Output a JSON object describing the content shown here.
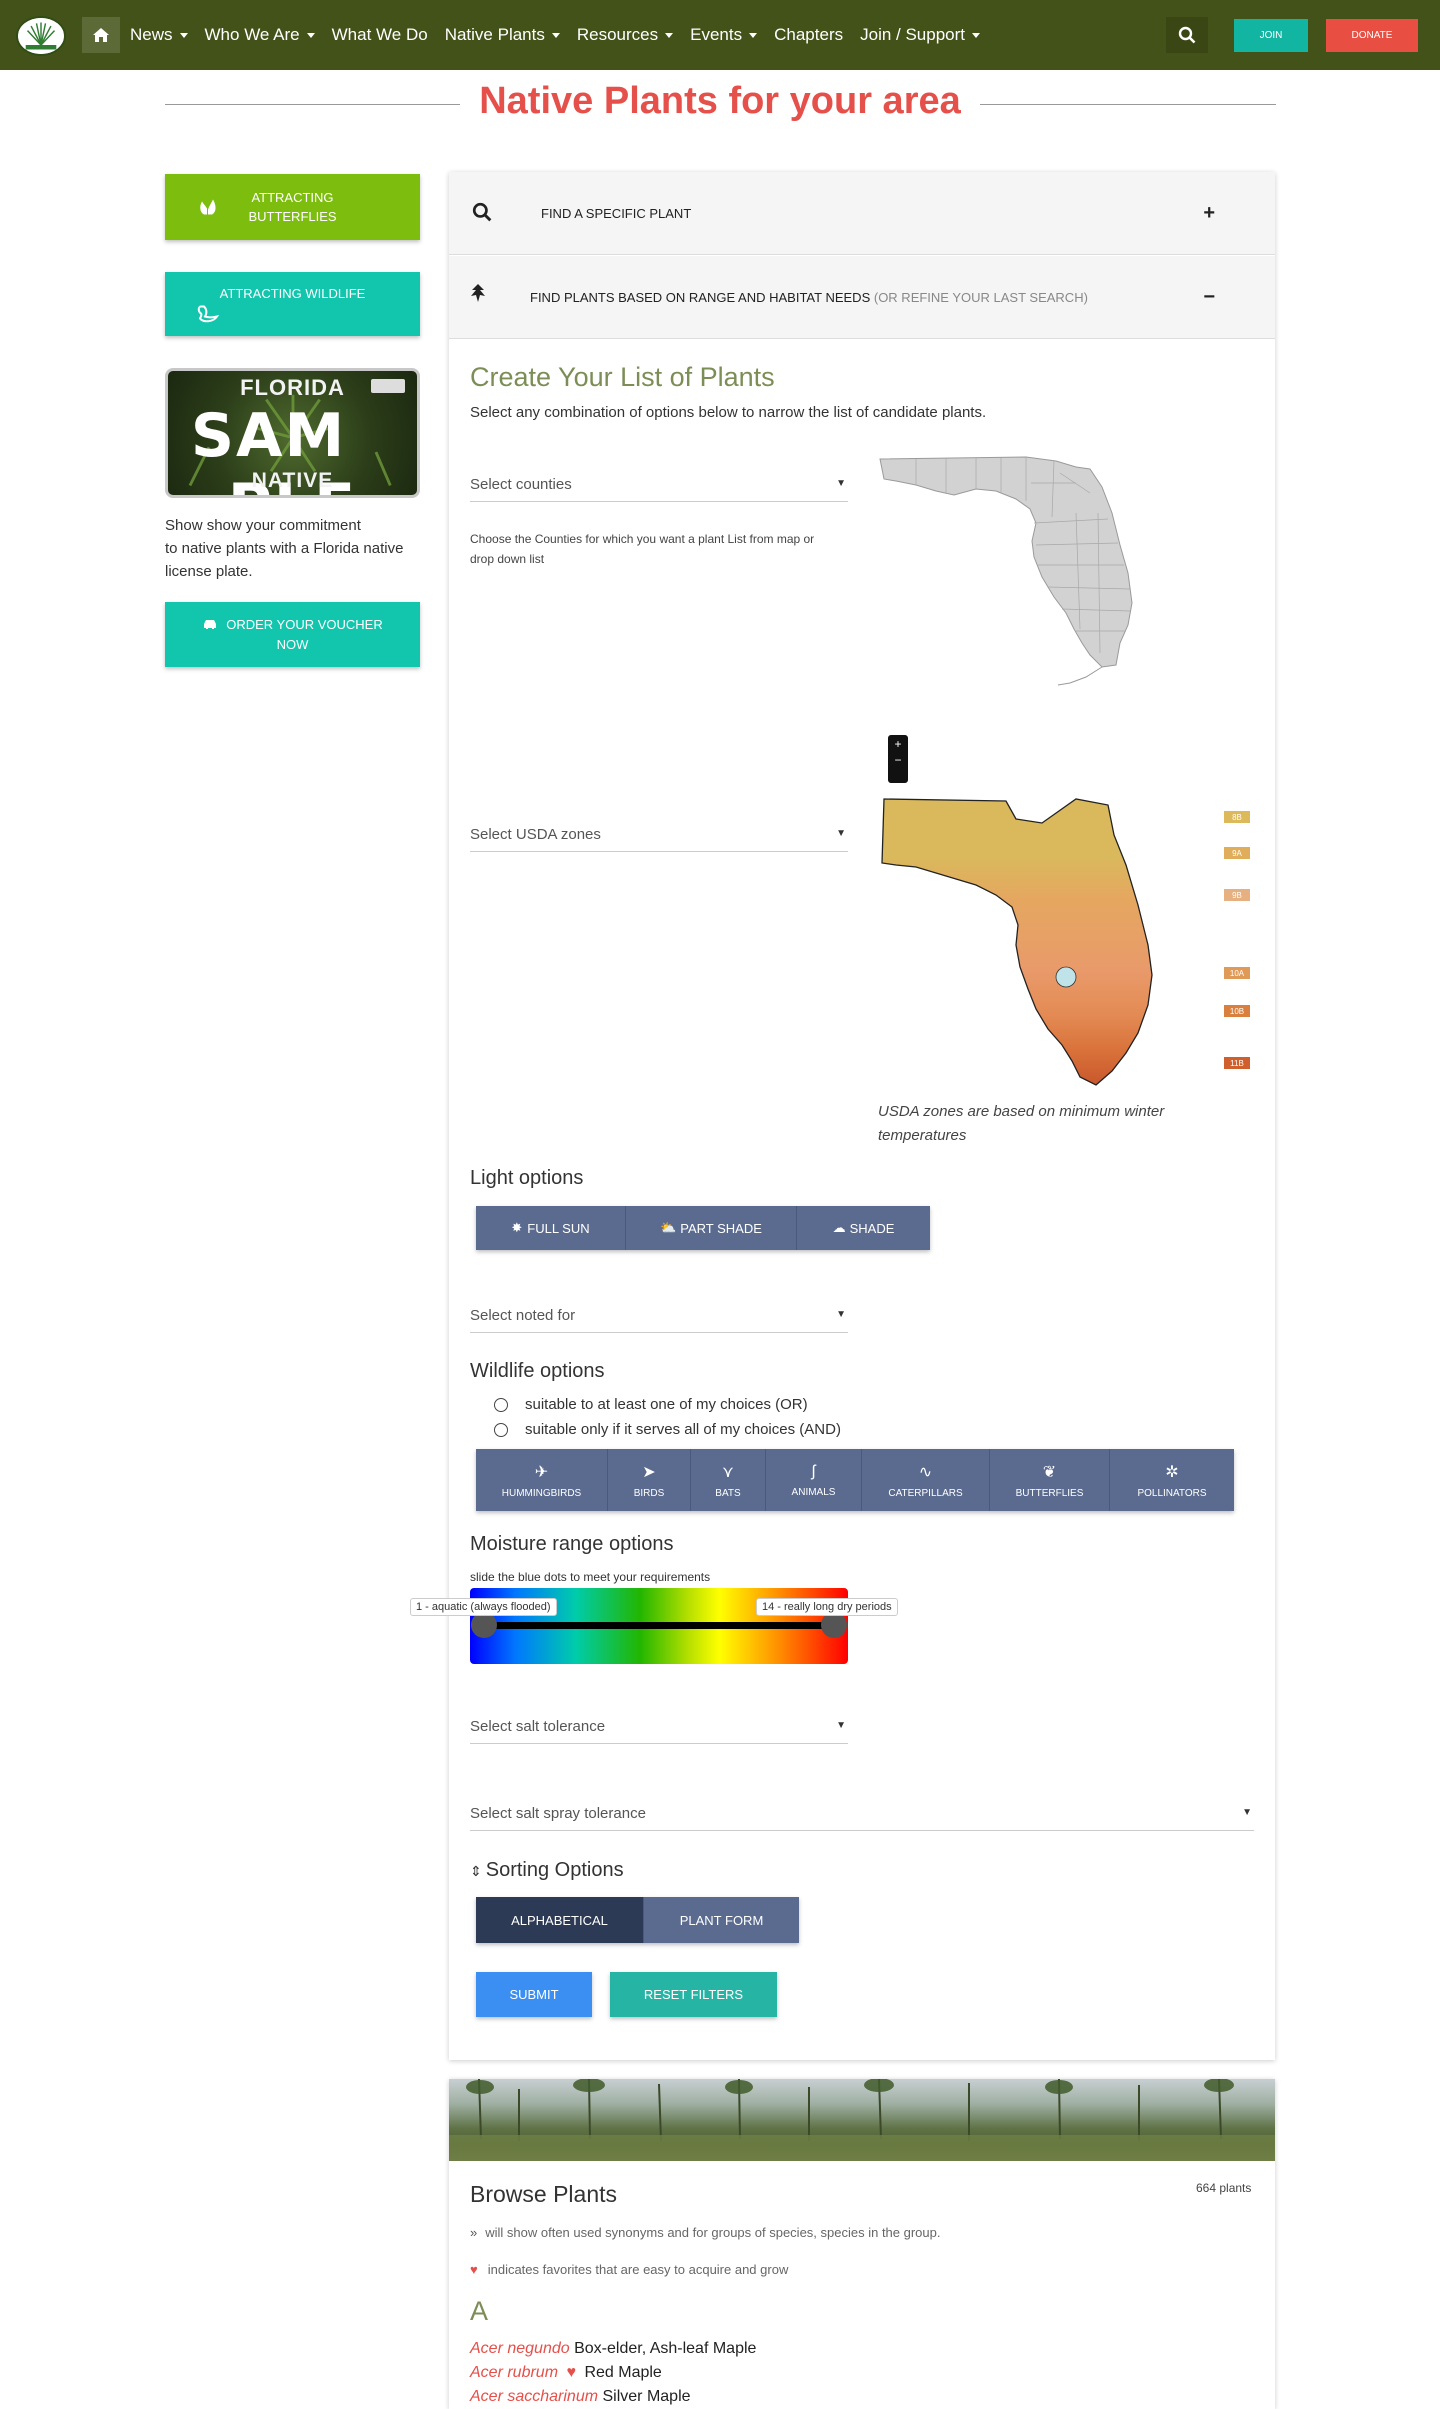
{
  "nav": {
    "items": [
      {
        "label": "News",
        "dropdown": true
      },
      {
        "label": "Who We Are",
        "dropdown": true
      },
      {
        "label": "What We Do",
        "dropdown": false
      },
      {
        "label": "Native Plants",
        "dropdown": true
      },
      {
        "label": "Resources",
        "dropdown": true
      },
      {
        "label": "Events",
        "dropdown": true
      },
      {
        "label": "Chapters",
        "dropdown": false
      },
      {
        "label": "Join / Support",
        "dropdown": true
      }
    ],
    "join_label": "JOIN",
    "donate_label": "DONATE"
  },
  "page_title": "Native Plants for your area",
  "sidebar": {
    "butterflies_label_1": "ATTRACTING",
    "butterflies_label_2": "BUTTERFLIES",
    "wildlife_label": "ATTRACTING WILDLIFE",
    "plate": {
      "top": "FLORIDA",
      "middle": "SAM",
      "middle2": "PLE",
      "bottom": "NATIVE"
    },
    "plate_text_1": "Show show your commitment",
    "plate_text_2": "to native plants with a Florida native",
    "plate_text_3": "license plate.",
    "voucher_label_1": "ORDER YOUR VOUCHER",
    "voucher_label_2": "NOW"
  },
  "accordion": {
    "find_specific": "FIND A SPECIFIC PLANT",
    "find_range": "FIND PLANTS BASED ON RANGE AND HABITAT NEEDS",
    "find_range_muted": "(OR REFINE YOUR LAST SEARCH)",
    "expand_sign": "+",
    "collapse_sign": "−"
  },
  "create": {
    "title": "Create Your List of Plants",
    "subtitle": "Select any combination of options below to narrow the list of candidate plants."
  },
  "counties": {
    "placeholder": "Select counties",
    "note_1": "Choose the Counties for which you want a plant List from map or",
    "note_2": "drop down list"
  },
  "usda": {
    "placeholder": "Select USDA zones",
    "note_1": "USDA zones are based on minimum winter",
    "note_2": "temperatures",
    "zones": [
      "8B",
      "9A",
      "9B",
      "10A",
      "10B",
      "11B"
    ]
  },
  "light": {
    "heading": "Light options",
    "buttons": [
      "FULL SUN",
      "PART SHADE",
      "SHADE"
    ]
  },
  "noted_for": {
    "placeholder": "Select noted for"
  },
  "wildlife": {
    "heading": "Wildlife options",
    "radio_or": "suitable to at least one of my choices (OR)",
    "radio_and": "suitable only if it serves all of my choices (AND)",
    "buttons": [
      "HUMMINGBIRDS",
      "BIRDS",
      "BATS",
      "ANIMALS",
      "CATERPILLARS",
      "BUTTERFLIES",
      "POLLINATORS"
    ]
  },
  "moisture": {
    "heading": "Moisture range options",
    "hint": "slide the blue dots to meet your requirements",
    "min_label": "1 - aquatic (always flooded)",
    "max_label": "14 - really long dry periods",
    "min_value": 1,
    "max_value": 14
  },
  "salt": {
    "placeholder": "Select salt tolerance"
  },
  "salt_spray": {
    "placeholder": "Select salt spray tolerance"
  },
  "sorting": {
    "heading": "Sorting Options",
    "buttons": [
      "ALPHABETICAL",
      "PLANT FORM"
    ]
  },
  "actions": {
    "submit": "SUBMIT",
    "reset": "RESET FILTERS"
  },
  "browse": {
    "title": "Browse Plants",
    "count": "664 plants",
    "note_synonyms": "will show often used synonyms and for groups of species, species in the group.",
    "note_favorites": "indicates favorites that are easy to acquire and grow",
    "letter": "A",
    "plants": [
      {
        "latin": "Acer negundo",
        "common": "Box-elder, Ash-leaf Maple",
        "favorite": false
      },
      {
        "latin": "Acer rubrum",
        "common": "Red Maple",
        "favorite": true
      },
      {
        "latin": "Acer saccharinum",
        "common": "Silver Maple",
        "favorite": false
      }
    ]
  },
  "colors": {
    "nav_bg": "#435219",
    "title_red": "#e5504a",
    "lime": "#7cbd0e",
    "teal": "#12c5ad",
    "button_slate": "#5a6b8f",
    "olive_heading": "#7c8e56"
  }
}
